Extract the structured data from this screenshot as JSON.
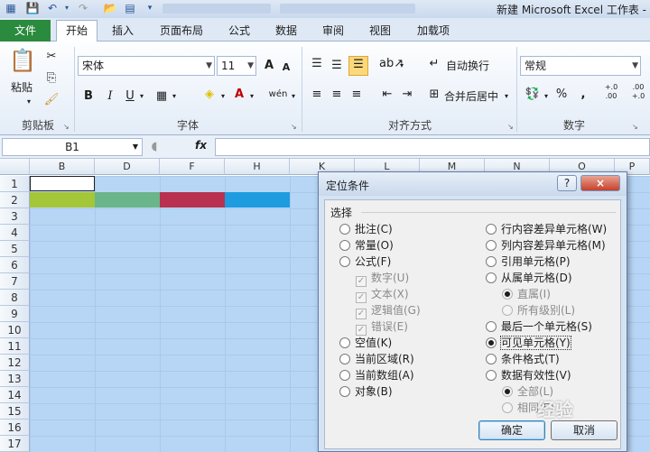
{
  "title": {
    "text": "新建 Microsoft Excel 工作表 -"
  },
  "tabs": [
    {
      "label": "文件"
    },
    {
      "label": "开始"
    },
    {
      "label": "插入"
    },
    {
      "label": "页面布局"
    },
    {
      "label": "公式"
    },
    {
      "label": "数据"
    },
    {
      "label": "审阅"
    },
    {
      "label": "视图"
    },
    {
      "label": "加载项"
    }
  ],
  "ribbon": {
    "paste": "粘贴",
    "clipboard": "剪贴板",
    "font_name": "宋体",
    "font_size": "11",
    "font_group": "字体",
    "wrap_text": "自动换行",
    "merge_center": "合并后居中",
    "align_group": "对齐方式",
    "number_format": "常规",
    "number_group": "数字",
    "bold": "B",
    "italic": "I",
    "underline": "U",
    "grow": "A",
    "shrink": "A",
    "percent": "%",
    "comma": ",",
    "inc_dec": "+.0 .00",
    "dec_dec": ".00 +.0",
    "wen": "wén"
  },
  "formula_bar": {
    "name_box": "B1",
    "fx": "fx"
  },
  "columns": [
    "B",
    "D",
    "F",
    "H",
    "K",
    "L",
    "M",
    "N",
    "O",
    "P"
  ],
  "rows": [
    "1",
    "2",
    "3",
    "4",
    "5",
    "6",
    "7",
    "8",
    "9",
    "10",
    "11",
    "12",
    "13",
    "14",
    "15",
    "16",
    "17"
  ],
  "colors": {
    "green": "#a4c639",
    "teal": "#6bb58a",
    "crimson": "#b8324f",
    "blue": "#1e9ce0",
    "grid": "#b7d6f5"
  },
  "dialog": {
    "title": "定位条件",
    "help": "?",
    "close": "×",
    "section": "选择",
    "left_options": [
      {
        "label": "批注(C)",
        "checked": false
      },
      {
        "label": "常量(O)",
        "checked": false
      },
      {
        "label": "公式(F)",
        "checked": false
      },
      {
        "label": "数字(U)",
        "sub": true
      },
      {
        "label": "文本(X)",
        "sub": true
      },
      {
        "label": "逻辑值(G)",
        "sub": true
      },
      {
        "label": "错误(E)",
        "sub": true
      },
      {
        "label": "空值(K)",
        "checked": false
      },
      {
        "label": "当前区域(R)",
        "checked": false
      },
      {
        "label": "当前数组(A)",
        "checked": false
      },
      {
        "label": "对象(B)",
        "checked": false
      }
    ],
    "right_options": [
      {
        "label": "行内容差异单元格(W)"
      },
      {
        "label": "列内容差异单元格(M)"
      },
      {
        "label": "引用单元格(P)"
      },
      {
        "label": "从属单元格(D)"
      },
      {
        "label": "直属(I)"
      },
      {
        "label": "所有级别(L)"
      },
      {
        "label": "最后一个单元格(S)"
      },
      {
        "label": "可见单元格(Y)"
      },
      {
        "label": "条件格式(T)"
      },
      {
        "label": "数据有效性(V)"
      },
      {
        "label": "全部(L)"
      },
      {
        "label": "相同(E)"
      }
    ],
    "ok": "确定",
    "cancel": "取消"
  },
  "watermark": "经验"
}
